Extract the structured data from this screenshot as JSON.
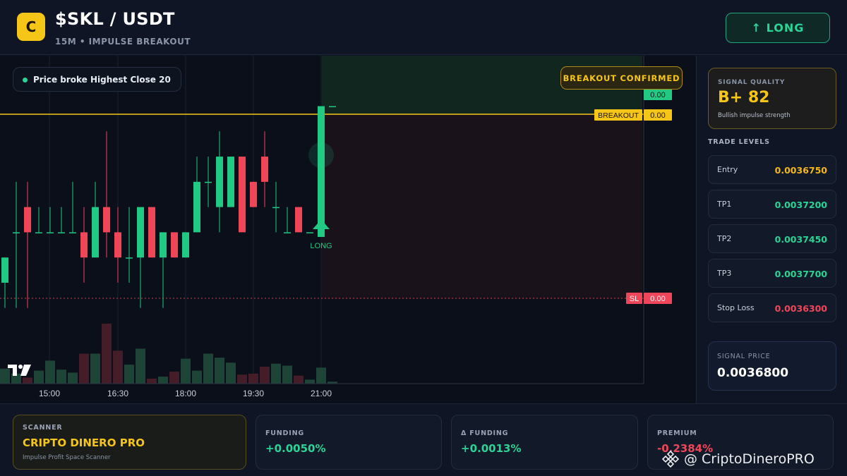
{
  "header": {
    "logo_letter": "C",
    "pair": "$SKL / USDT",
    "subtitle": "15M • IMPULSE BREAKOUT",
    "long_button": "↑ LONG"
  },
  "chart": {
    "info_pill": "Price broke Highest Close 20",
    "confirm_badge": "BREAKOUT CONFIRMED",
    "breakout_label": "BREAKOUT",
    "breakout_value": "0.00",
    "top_value": "0.00",
    "sl_label": "SL",
    "sl_value": "0.00",
    "long_marker": "LONG",
    "time_labels": [
      "15:00",
      "16:30",
      "18:00",
      "19:30",
      "21:00"
    ],
    "colors": {
      "bull": "#22c983",
      "bear": "#f0465a",
      "breakout": "#f5c518",
      "bg": "#0b0f1a"
    }
  },
  "chart_data": {
    "type": "candlestick",
    "x": [
      "15:00",
      "16:30",
      "18:00",
      "19:30",
      "21:00"
    ],
    "ohlc": [
      [
        0.00362,
        0.00363,
        0.00361,
        0.00363
      ],
      [
        0.00364,
        0.00366,
        0.00361,
        0.00364
      ],
      [
        0.00365,
        0.00366,
        0.00361,
        0.00364
      ],
      [
        0.00364,
        0.00365,
        0.00364,
        0.00364
      ],
      [
        0.00364,
        0.00365,
        0.00364,
        0.00364
      ],
      [
        0.00364,
        0.00365,
        0.00364,
        0.00364
      ],
      [
        0.00364,
        0.00366,
        0.00364,
        0.00364
      ],
      [
        0.00364,
        0.00365,
        0.00362,
        0.00363
      ],
      [
        0.00363,
        0.00366,
        0.00363,
        0.00365
      ],
      [
        0.00365,
        0.00368,
        0.00363,
        0.00364
      ],
      [
        0.00364,
        0.00365,
        0.00362,
        0.00363
      ],
      [
        0.00363,
        0.00365,
        0.00362,
        0.00363
      ],
      [
        0.00363,
        0.00365,
        0.00361,
        0.00365
      ],
      [
        0.00365,
        0.00365,
        0.00363,
        0.00363
      ],
      [
        0.00363,
        0.00364,
        0.00361,
        0.00364
      ],
      [
        0.00364,
        0.00364,
        0.00363,
        0.00363
      ],
      [
        0.00363,
        0.00364,
        0.00363,
        0.00364
      ],
      [
        0.00364,
        0.00367,
        0.00364,
        0.00366
      ],
      [
        0.00366,
        0.00367,
        0.00365,
        0.00366
      ],
      [
        0.00365,
        0.00368,
        0.00364,
        0.00367
      ],
      [
        0.00365,
        0.00367,
        0.00365,
        0.00367
      ],
      [
        0.00367,
        0.00367,
        0.00365,
        0.00364
      ],
      [
        0.00366,
        0.00366,
        0.00365,
        0.00365
      ],
      [
        0.00367,
        0.00368,
        0.00365,
        0.00366
      ],
      [
        0.00365,
        0.00366,
        0.00364,
        0.00365
      ],
      [
        0.00364,
        0.00365,
        0.00364,
        0.00364
      ],
      [
        0.00365,
        0.00365,
        0.00364,
        0.00364
      ],
      [
        0.00364,
        0.00364,
        0.00364,
        0.00364
      ],
      [
        0.00364,
        0.00369,
        0.00364,
        0.00369
      ],
      [
        0.00369,
        0.00369,
        0.00369,
        0.00369
      ]
    ],
    "volume": [
      1.5,
      1.0,
      0.6,
      1.3,
      2.3,
      1.4,
      1.1,
      3.0,
      3.0,
      6.0,
      3.3,
      1.9,
      3.5,
      0.5,
      0.7,
      1.2,
      2.5,
      1.3,
      3.0,
      2.6,
      2.1,
      0.9,
      1.0,
      1.7,
      2.0,
      1.8,
      0.8,
      0.4,
      1.6,
      0.2
    ],
    "breakout_level": 0.003675,
    "stop_level": 0.00363,
    "ylim": [
      0.00358,
      0.00371
    ]
  },
  "signal": {
    "quality_label": "SIGNAL QUALITY",
    "quality_value": "B+ 82",
    "quality_desc": "Bullish impulse strength",
    "levels_title": "TRADE LEVELS",
    "levels": [
      {
        "label": "Entry",
        "value": "0.0036750",
        "color": "#f5b81b"
      },
      {
        "label": "TP1",
        "value": "0.0037200",
        "color": "#2ad396"
      },
      {
        "label": "TP2",
        "value": "0.0037450",
        "color": "#2ad396"
      },
      {
        "label": "TP3",
        "value": "0.0037700",
        "color": "#2ad396"
      },
      {
        "label": "Stop Loss",
        "value": "0.0036300",
        "color": "#f0465a"
      }
    ],
    "price_label": "SIGNAL PRICE",
    "price_value": "0.0036800"
  },
  "bottom": {
    "scanner_label": "SCANNER",
    "scanner_name": "CRIPTO DINERO PRO",
    "scanner_desc": "Impulse Profit Space Scanner",
    "funding_label": "FUNDING",
    "funding_value": "+0.0050%",
    "dfunding_label": "Δ FUNDING",
    "dfunding_value": "+0.0013%",
    "premium_label": "PREMIUM",
    "premium_value": "-0.2384%",
    "watermark": "@ CriptoDineroPRO"
  }
}
